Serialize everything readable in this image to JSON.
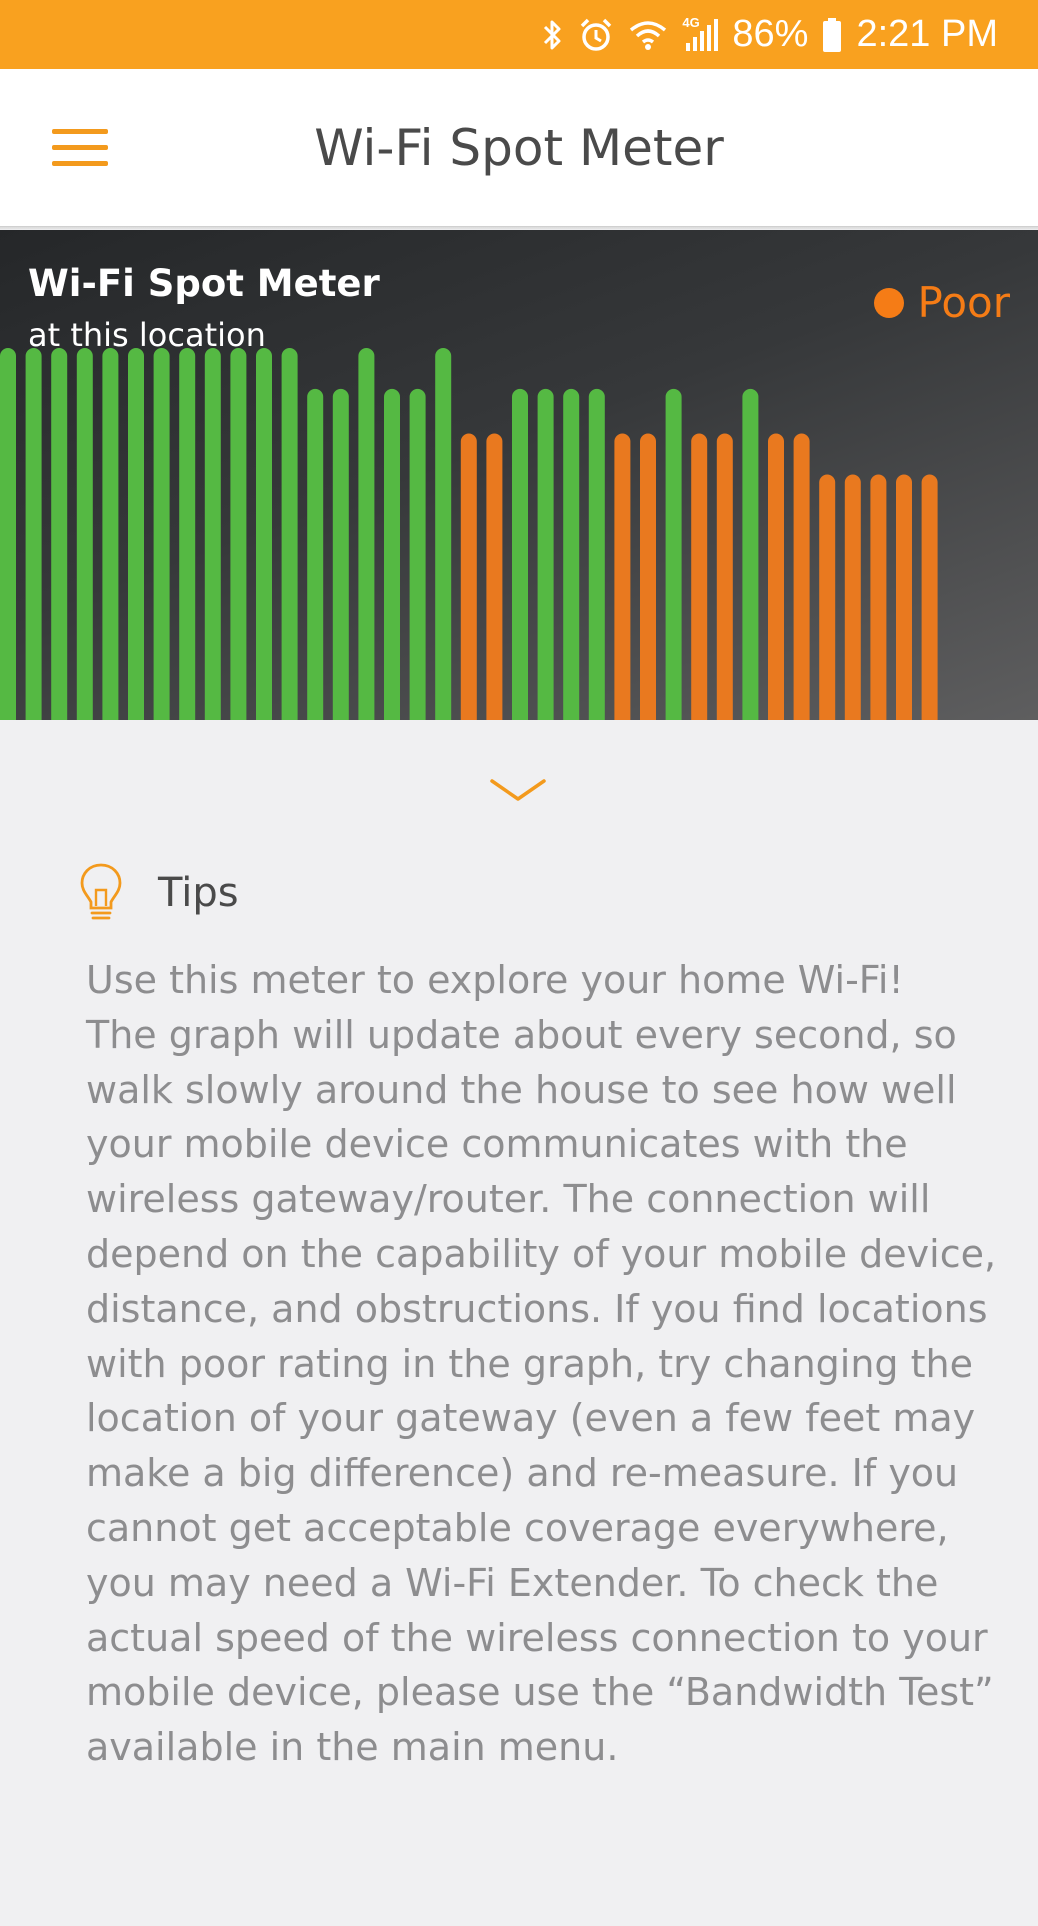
{
  "status_bar": {
    "battery": "86%",
    "time": "2:21 PM",
    "network": "4G",
    "icons": [
      "bluetooth-icon",
      "alarm-icon",
      "wifi-icon",
      "signal-icon",
      "battery-icon"
    ],
    "color": "#f9a11f"
  },
  "app_bar": {
    "title": "Wi-Fi Spot Meter",
    "menu_icon": "hamburger-menu-icon"
  },
  "meter": {
    "title": "Wi-Fi Spot Meter",
    "subtitle": "at this location",
    "rating": "Poor",
    "rating_color": "#f57c16"
  },
  "chart_data": {
    "type": "bar",
    "good_color": "#55b943",
    "poor_color": "#e9791f",
    "ylim": [
      0,
      1
    ],
    "series": [
      {
        "values": [
          1,
          1,
          1,
          1,
          1,
          1,
          1,
          1,
          1,
          1,
          1,
          1,
          0.89,
          0.89,
          1,
          0.89,
          0.89,
          1,
          0.77,
          0.77,
          0.89,
          0.89,
          0.89,
          0.89,
          0.77,
          0.77,
          0.89,
          0.77,
          0.77,
          0.89,
          0.77,
          0.77,
          0.66,
          0.66,
          0.66,
          0.66,
          0.66
        ],
        "quality": [
          "good",
          "good",
          "good",
          "good",
          "good",
          "good",
          "good",
          "good",
          "good",
          "good",
          "good",
          "good",
          "good",
          "good",
          "good",
          "good",
          "good",
          "good",
          "poor",
          "poor",
          "good",
          "good",
          "good",
          "good",
          "poor",
          "poor",
          "good",
          "poor",
          "poor",
          "good",
          "poor",
          "poor",
          "poor",
          "poor",
          "poor",
          "poor",
          "poor"
        ]
      }
    ]
  },
  "expand_icon": "chevron-down-icon",
  "tips": {
    "icon": "lightbulb-icon",
    "heading": "Tips",
    "body": "Use this meter to explore your home Wi-Fi!\nThe graph will update about every second, so\nwalk slowly around the house to see how well\nyour mobile device communicates with the\nwireless gateway/router. The connection will\ndepend on the capability of your mobile device,\ndistance, and obstructions. If you find locations\nwith poor rating in the graph, try changing the\nlocation of your gateway (even a few feet may\nmake a big difference) and re-measure. If you\ncannot get acceptable coverage everywhere,\nyou may need a Wi-Fi Extender. To check the\nactual speed of the wireless connection to your\nmobile device, please use the “Bandwidth Test”\navailable in the main menu."
  }
}
